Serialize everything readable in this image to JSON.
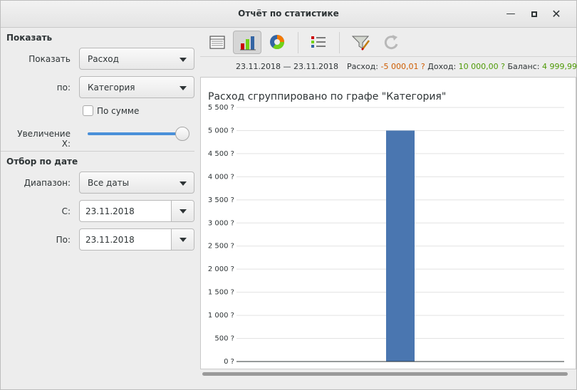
{
  "window": {
    "title": "Отчёт по статистике"
  },
  "left": {
    "show_section": "Показать",
    "show_label": "Показать",
    "show_value": "Расход",
    "by_label": "по:",
    "by_value": "Категория",
    "sum_checkbox": "По сумме",
    "sum_checked": false,
    "zoom_label": "Увеличение X:",
    "zoom_level": 1.0,
    "date_section": "Отбор по дате",
    "range_label": "Диапазон:",
    "range_value": "Все даты",
    "from_label": "С:",
    "from_value": "23.11.2018",
    "to_label": "По:",
    "to_value": "23.11.2018"
  },
  "toolbar": {
    "items": [
      "table-view-icon",
      "bar-chart-icon",
      "pie-chart-icon",
      "list-icon",
      "filter-icon",
      "refresh-icon"
    ],
    "active": "bar-chart-icon"
  },
  "summary": {
    "date_range": "23.11.2018 — 23.11.2018",
    "expense_label": "Расход:",
    "expense_value": "-5 000,01 ?",
    "income_label": "Доход:",
    "income_value": "10 000,00 ?",
    "balance_label": "Баланс:",
    "balance_value": "4 999,99 ?"
  },
  "colors": {
    "bar": "#4a76b0",
    "negative": "#ce5c00",
    "positive": "#4e9a06",
    "accent": "#4a90d9"
  },
  "chart_data": {
    "type": "bar",
    "title": "Расход сгруппировано по графе \"Категория\"",
    "categories": [
      ""
    ],
    "values": [
      5000.01
    ],
    "ylim": [
      0,
      5500
    ],
    "yticks": [
      0,
      500,
      1000,
      1500,
      2000,
      2500,
      3000,
      3500,
      4000,
      4500,
      5000,
      5500
    ],
    "ytick_labels": [
      "0 ?",
      "500 ?",
      "1 000 ?",
      "1 500 ?",
      "2 000 ?",
      "2 500 ?",
      "3 000 ?",
      "3 500 ?",
      "4 000 ?",
      "4 500 ?",
      "5 000 ?",
      "5 500 ?"
    ],
    "grid": true
  }
}
